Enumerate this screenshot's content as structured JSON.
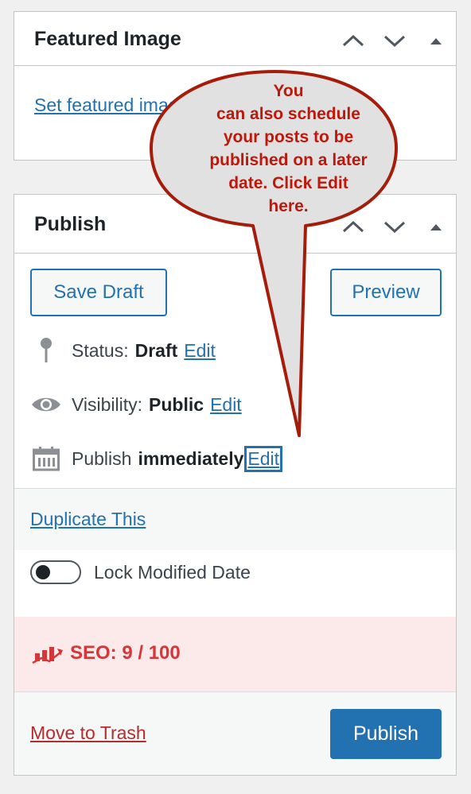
{
  "featured_image": {
    "title": "Featured Image",
    "set_link": "Set featured image"
  },
  "publish": {
    "title": "Publish",
    "save_draft": "Save Draft",
    "preview": "Preview",
    "status_label": "Status:",
    "status_value": "Draft",
    "visibility_label": "Visibility:",
    "visibility_value": "Public",
    "schedule_label": "Publish",
    "schedule_value": "immediately",
    "edit_label": "Edit",
    "duplicate_link": "Duplicate This",
    "lock_modified_label": "Lock Modified Date",
    "lock_modified_on": false,
    "seo_label": "SEO: 9 / 100",
    "trash_link": "Move to Trash",
    "publish_button": "Publish"
  },
  "callout": {
    "line1": "You",
    "line2": "can also schedule",
    "line3": "your posts to be",
    "line4": "published on a later",
    "line5": "date. Click Edit",
    "line6": "here."
  },
  "icons": {
    "move_up": "chevron-up-icon",
    "move_down": "chevron-down-icon",
    "toggle_panel": "caret-up-icon",
    "status": "pin-icon",
    "visibility": "eye-icon",
    "schedule": "calendar-icon",
    "seo": "seo-chart-icon"
  },
  "colors": {
    "link": "#2271b1",
    "primary_button": "#2271b1",
    "trash_link": "#b32d2e",
    "seo_text": "#d63638",
    "seo_background": "#fce9e9",
    "callout_fill": "#e1e1e1",
    "callout_border": "#a51d0a",
    "callout_text": "#c0170b"
  }
}
